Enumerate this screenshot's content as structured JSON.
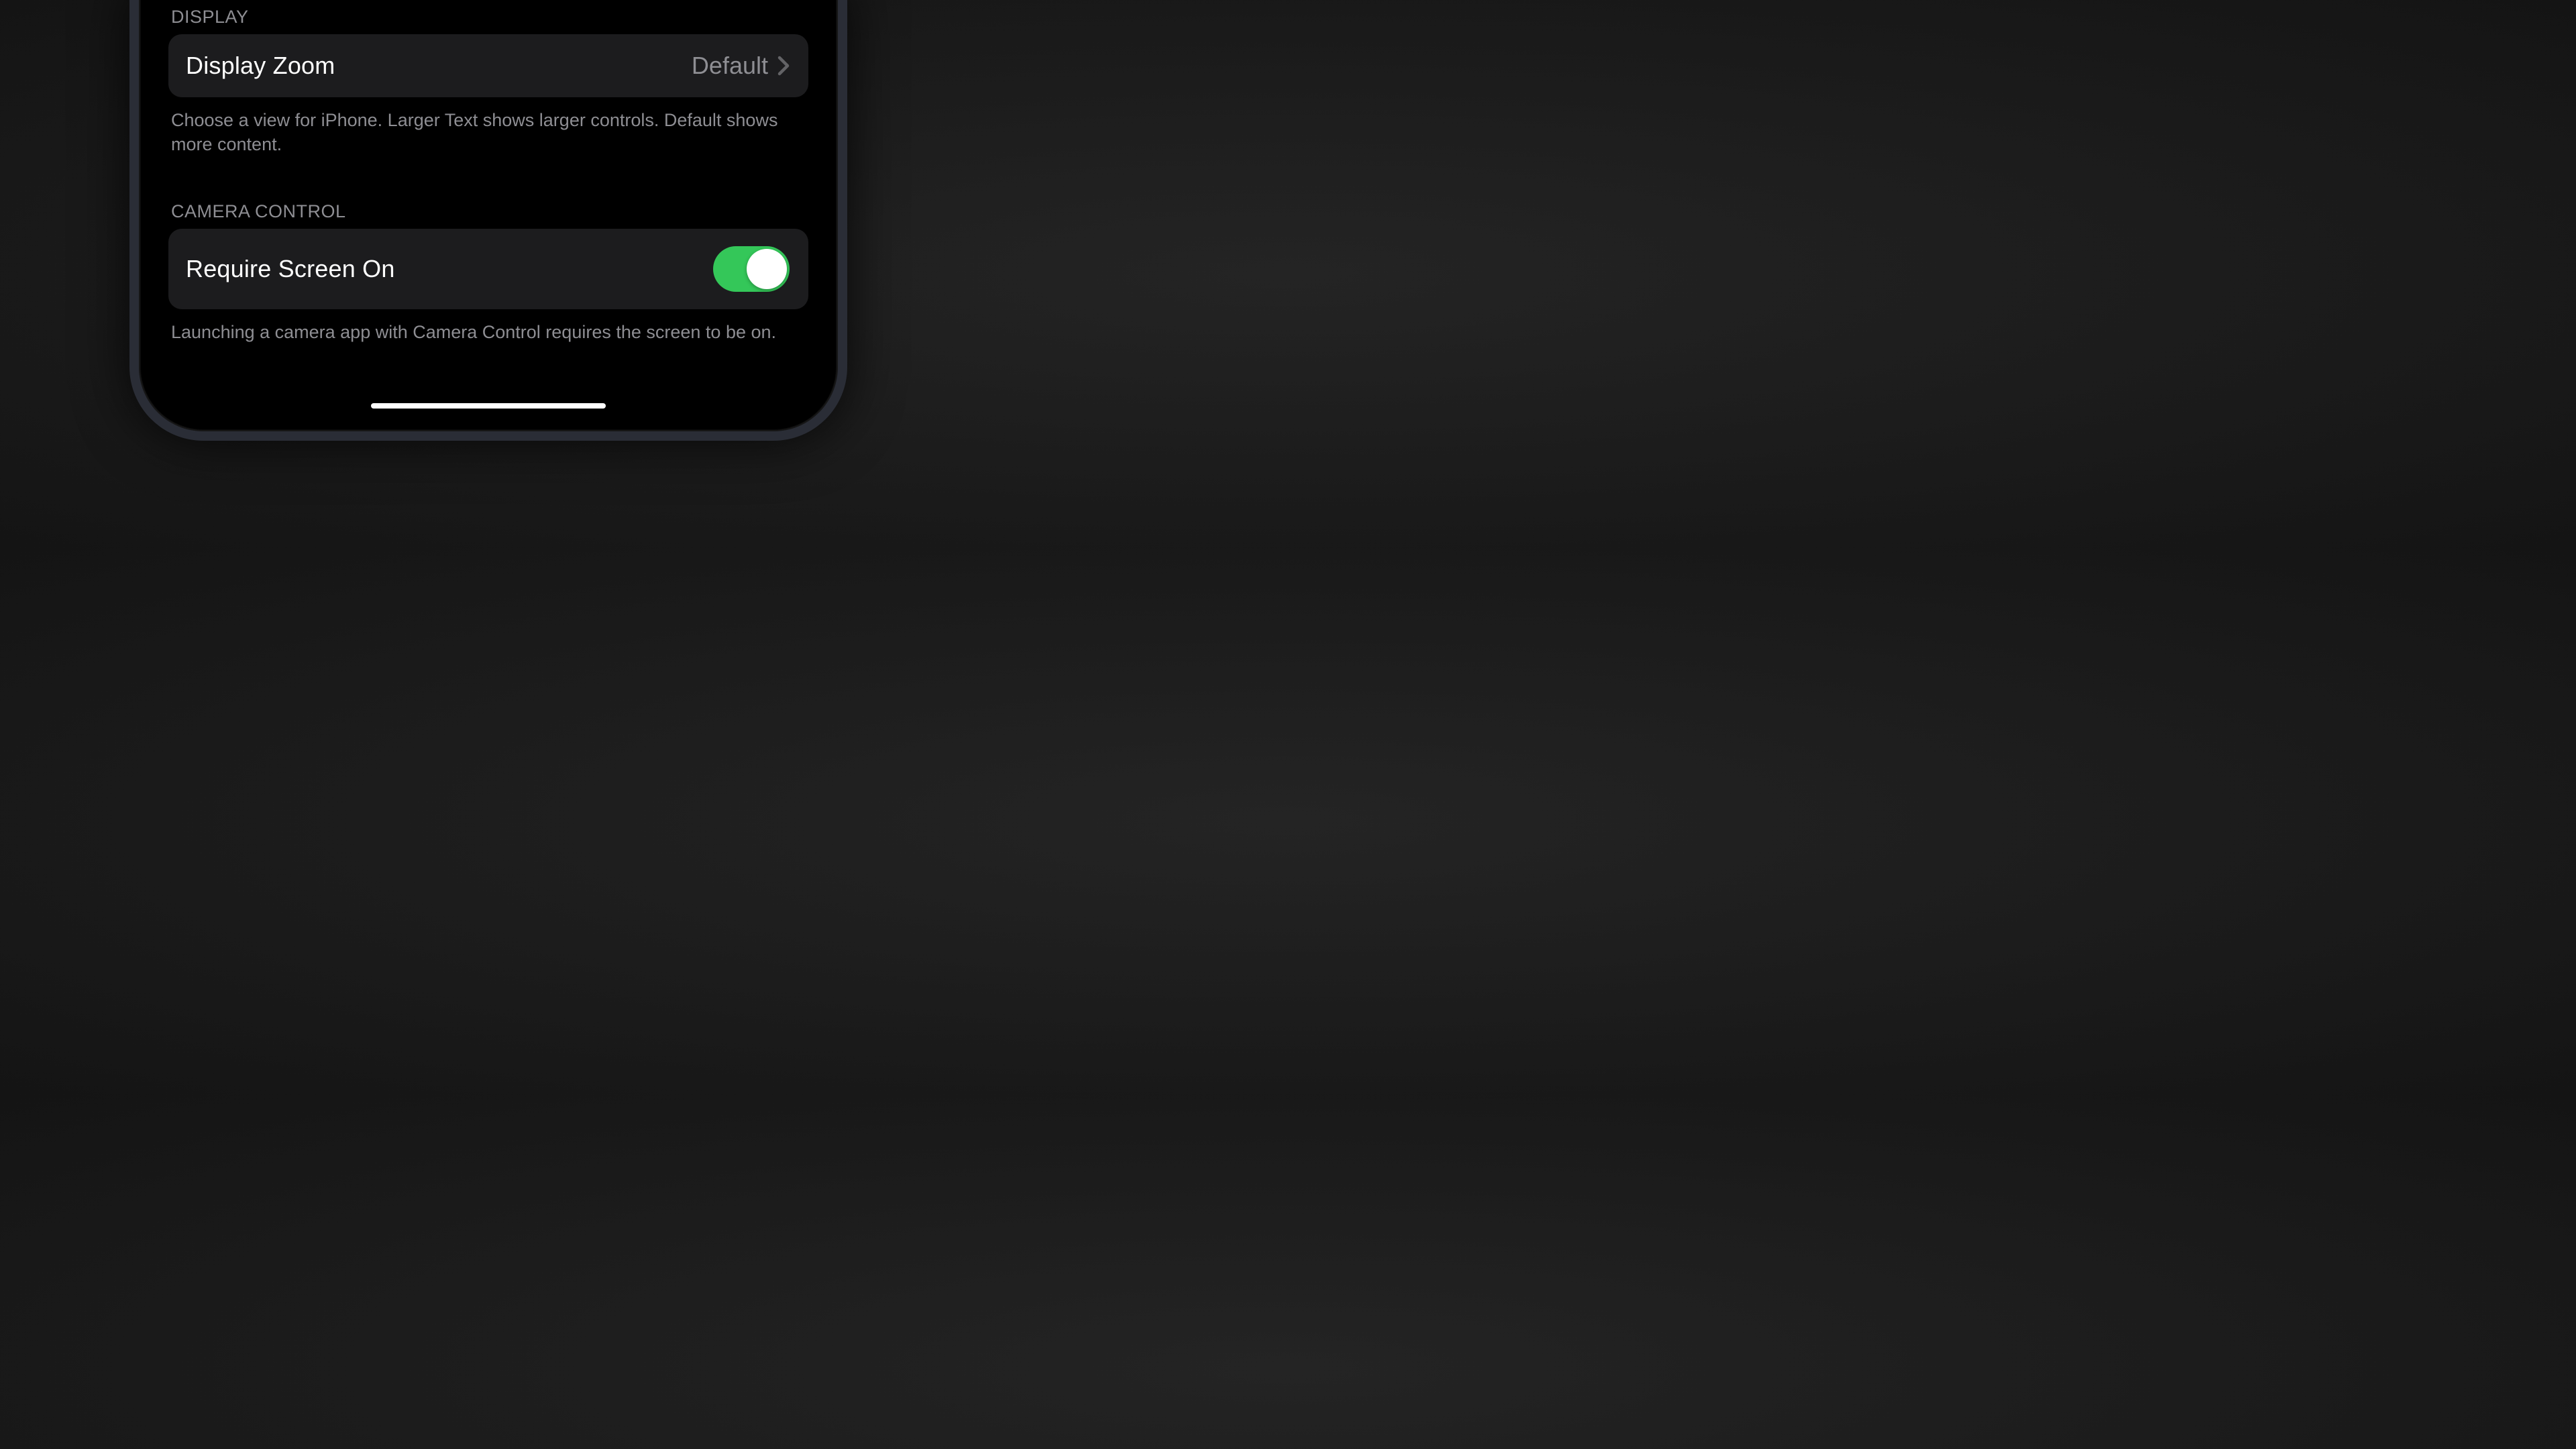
{
  "sections": {
    "display": {
      "header": "DISPLAY",
      "zoom": {
        "label": "Display Zoom",
        "value": "Default"
      },
      "footer": "Choose a view for iPhone. Larger Text shows larger controls. Default shows more content."
    },
    "cameraControl": {
      "header": "CAMERA CONTROL",
      "requireScreenOn": {
        "label": "Require Screen On",
        "enabled": true
      },
      "footer": "Launching a camera app with Camera Control requires the screen to be on."
    }
  }
}
